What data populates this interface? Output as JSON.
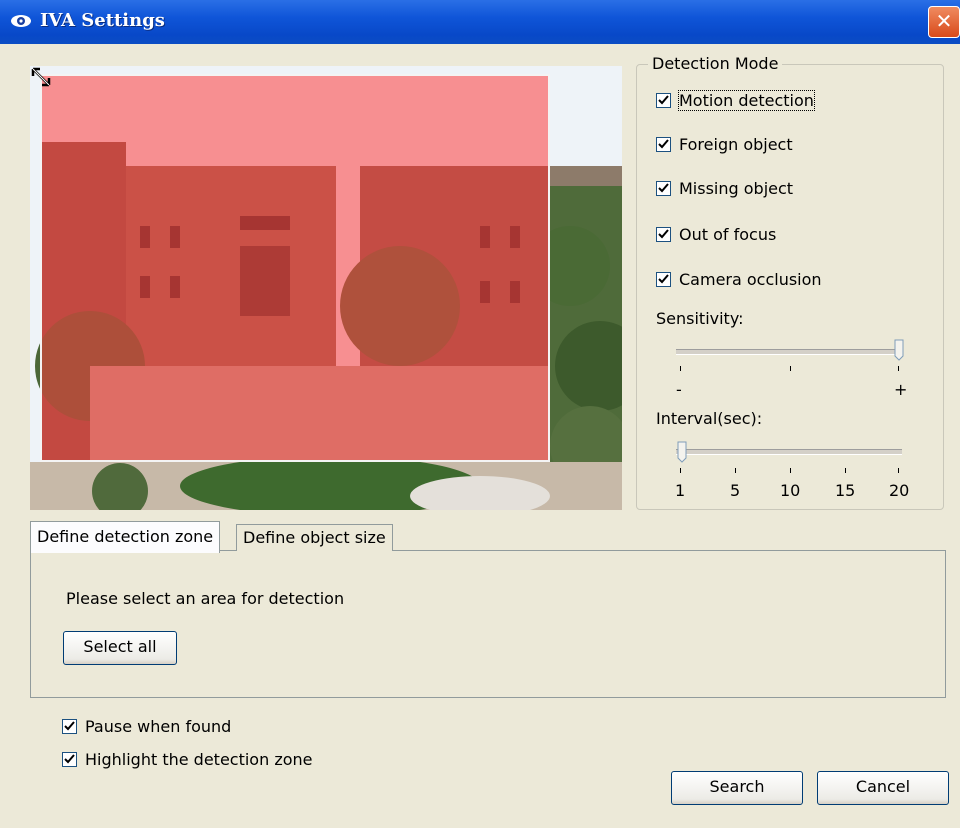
{
  "window": {
    "title": "IVA Settings",
    "close_label": "✕"
  },
  "detection_mode": {
    "legend": "Detection Mode",
    "options": [
      {
        "label": "Motion detection",
        "checked": true
      },
      {
        "label": "Foreign object",
        "checked": true
      },
      {
        "label": "Missing object",
        "checked": true
      },
      {
        "label": "Out of focus",
        "checked": true
      },
      {
        "label": "Camera occlusion",
        "checked": true
      }
    ],
    "sensitivity": {
      "label": "Sensitivity:",
      "min_label": "-",
      "max_label": "+",
      "value": 1.0
    },
    "interval": {
      "label": "Interval(sec):",
      "ticks": [
        "1",
        "5",
        "10",
        "15",
        "20"
      ],
      "value": 1
    }
  },
  "tabs": [
    {
      "label": "Define detection zone",
      "active": true
    },
    {
      "label": "Define object size",
      "active": false
    }
  ],
  "zone_panel": {
    "instruction": "Please select an area for detection",
    "select_all_label": "Select all"
  },
  "options": [
    {
      "label": "Pause when found",
      "checked": true
    },
    {
      "label": "Highlight the detection zone",
      "checked": true
    }
  ],
  "buttons": {
    "search": "Search",
    "cancel": "Cancel"
  },
  "colors": {
    "titlebar": "#0a4fd2",
    "zone_overlay": "#ff3c3c",
    "dialog_bg": "#ece9d8"
  }
}
